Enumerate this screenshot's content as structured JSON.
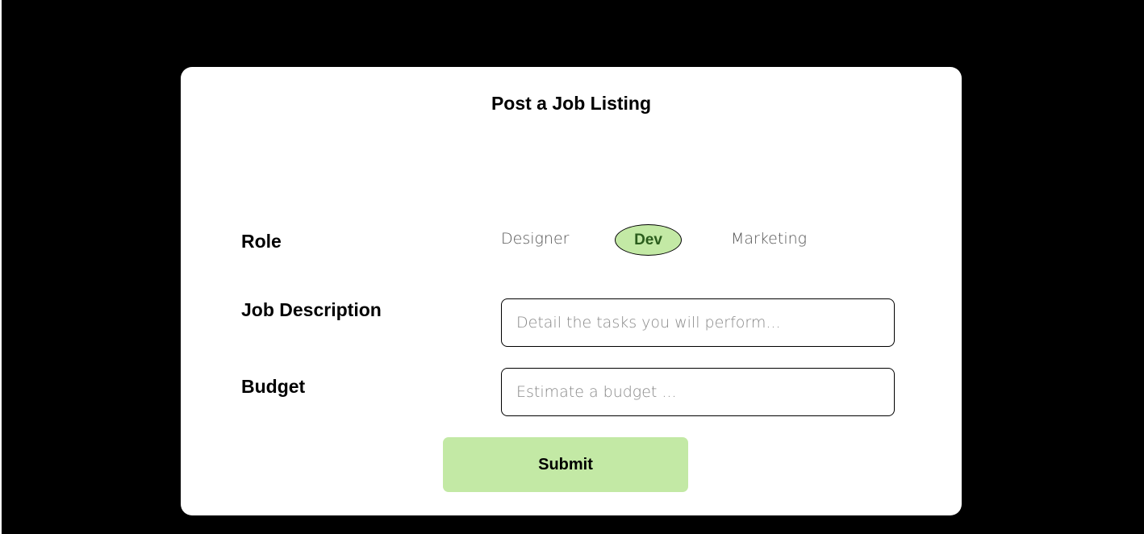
{
  "form": {
    "title": "Post a Job Listing",
    "role": {
      "label": "Role",
      "options": [
        {
          "label": "Designer",
          "selected": false
        },
        {
          "label": "Dev",
          "selected": true
        },
        {
          "label": "Marketing",
          "selected": false
        }
      ]
    },
    "job_description": {
      "label": "Job Description",
      "value": "",
      "placeholder": "Detail the tasks you will perform..."
    },
    "budget": {
      "label": "Budget",
      "value": "",
      "placeholder": "Estimate a budget ..."
    },
    "submit_label": "Submit"
  },
  "colors": {
    "background": "#000000",
    "card": "#ffffff",
    "accent": "#c3e9a5",
    "accent_text": "#2b5d1d"
  }
}
